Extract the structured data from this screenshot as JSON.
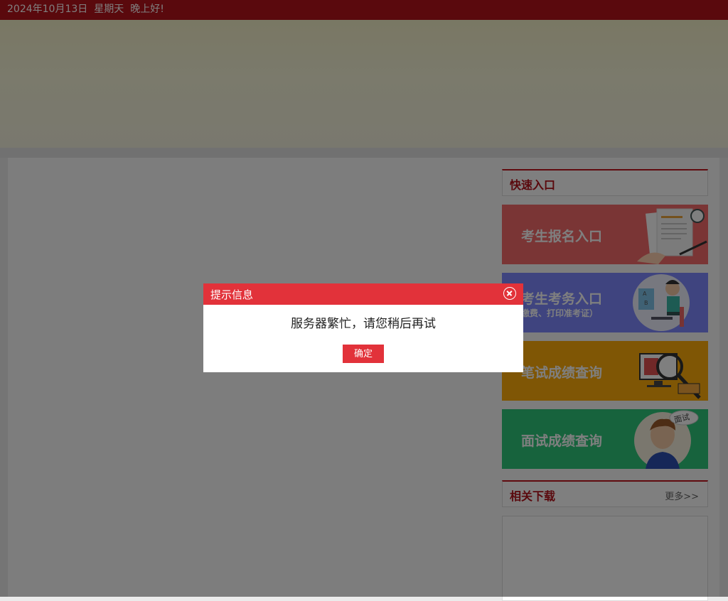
{
  "topbar": {
    "date": "2024年10月13日",
    "weekday": "星期天",
    "greeting": "晚上好!"
  },
  "quick_entry": {
    "title": "快速入口",
    "tiles": [
      {
        "label": "考生报名入口",
        "sublabel": "",
        "color": "#f46a6a",
        "icon": "application-form-icon"
      },
      {
        "label": "考生考务入口",
        "sublabel": "缴费、打印准考证）",
        "color": "#7e89ff",
        "icon": "student-computer-icon"
      },
      {
        "label": "笔试成绩查询",
        "sublabel": "",
        "color": "#ffac0b",
        "icon": "magnifier-monitor-icon"
      },
      {
        "label": "面试成绩查询",
        "sublabel": "",
        "color": "#2fc77a",
        "icon": "interview-avatar-icon",
        "badge": "面试"
      }
    ]
  },
  "downloads": {
    "title": "相关下载",
    "more": "更多>>"
  },
  "dialog": {
    "title": "提示信息",
    "message": "服务器繁忙，请您稍后再试",
    "confirm": "确定"
  },
  "colors": {
    "primary": "#b5121b",
    "dialog_header": "#e2323a"
  }
}
